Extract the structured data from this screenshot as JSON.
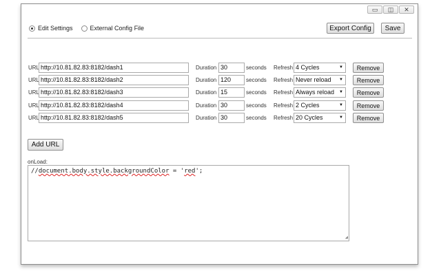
{
  "window": {
    "controls": {
      "minimize": "▭",
      "maximize": "◫",
      "close": "✕"
    }
  },
  "mode": {
    "options": [
      {
        "label": "Edit Settings",
        "selected": true
      },
      {
        "label": "External Config File",
        "selected": false
      }
    ]
  },
  "toolbar": {
    "export_label": "Export Config",
    "save_label": "Save"
  },
  "labels": {
    "url": "URL",
    "duration": "Duration",
    "seconds": "seconds",
    "refresh": "Refresh",
    "remove": "Remove",
    "select_arrow": "▼"
  },
  "rows": [
    {
      "url": "http://10.81.82.83:8182/dash1",
      "duration": "30",
      "refresh": "4 Cycles"
    },
    {
      "url": "http://10.81.82.83:8182/dash2",
      "duration": "120",
      "refresh": "Never reload"
    },
    {
      "url": "http://10.81.82.83:8182/dash3",
      "duration": "15",
      "refresh": "Always reload"
    },
    {
      "url": "http://10.81.82.83:8182/dash4",
      "duration": "30",
      "refresh": "2 Cycles"
    },
    {
      "url": "http://10.81.82.83:8182/dash5",
      "duration": "30",
      "refresh": "20 Cycles"
    }
  ],
  "add_url_label": "Add URL",
  "onload": {
    "label": "onLoad:",
    "code_prefix": "//",
    "code_obj": "document.body.style.backgroundColor",
    "code_mid": " = '",
    "code_str": "red",
    "code_suffix": "';",
    "grip": "◢"
  }
}
